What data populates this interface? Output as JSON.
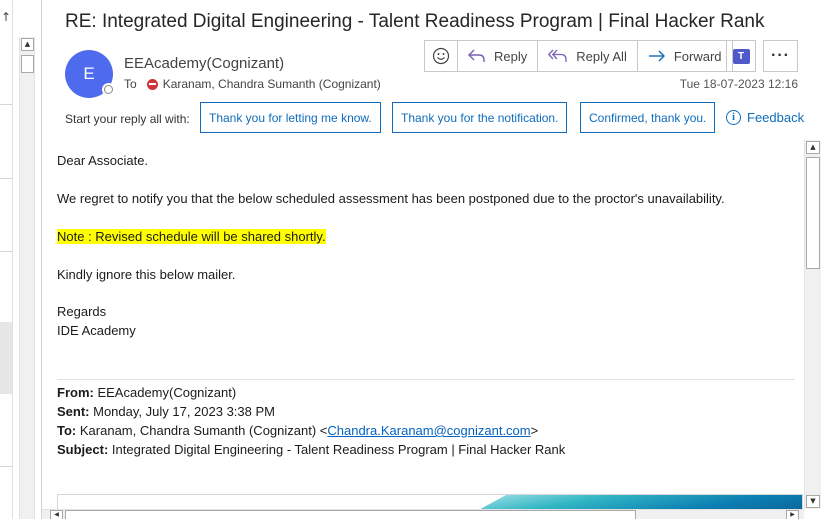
{
  "window": {
    "left_pane_glyph": "↑"
  },
  "header": {
    "subject": "RE: Integrated Digital Engineering - Talent Readiness Program | Final Hacker Rank",
    "avatar_initial": "E",
    "avatar_color": "#4f6bed",
    "sender": "EEAcademy(Cognizant)",
    "to_label": "To",
    "recipient": "Karanam, Chandra Sumanth (Cognizant)",
    "date": "Tue 18-07-2023 12:16"
  },
  "actions": {
    "emoji_icon": "smiley-icon",
    "reply": "Reply",
    "reply_all": "Reply All",
    "forward": "Forward",
    "teams_label": "T",
    "more": "···"
  },
  "quick_replies": {
    "label": "Start your reply all with:",
    "items": [
      "Thank you for letting me know.",
      "Thank you for the notification.",
      "Confirmed, thank you."
    ],
    "feedback": "Feedback",
    "info_icon": "i"
  },
  "body": {
    "greeting": "Dear Associate.",
    "line1": "We regret to notify you that the below scheduled assessment has been postponed due to the proctor's unavailability.",
    "note": "Note : Revised schedule will be shared shortly.",
    "line2": "Kindly ignore this below mailer.",
    "regards": "Regards",
    "signature": "IDE Academy"
  },
  "quoted": {
    "from_label": "From:",
    "from": "EEAcademy(Cognizant)",
    "sent_label": "Sent:",
    "sent": "Monday, July 17, 2023 3:38 PM",
    "to_label": "To:",
    "to_name": "Karanam, Chandra Sumanth (Cognizant) <",
    "to_email": "Chandra.Karanam@cognizant.com",
    "to_close": ">",
    "subject_label": "Subject:",
    "subject": "Integrated Digital Engineering - Talent Readiness Program | Final Hacker Rank"
  },
  "colors": {
    "accent": "#0f6cbd",
    "highlight": "#ffff00",
    "link": "#0563c1",
    "blocked": "#d13438"
  }
}
